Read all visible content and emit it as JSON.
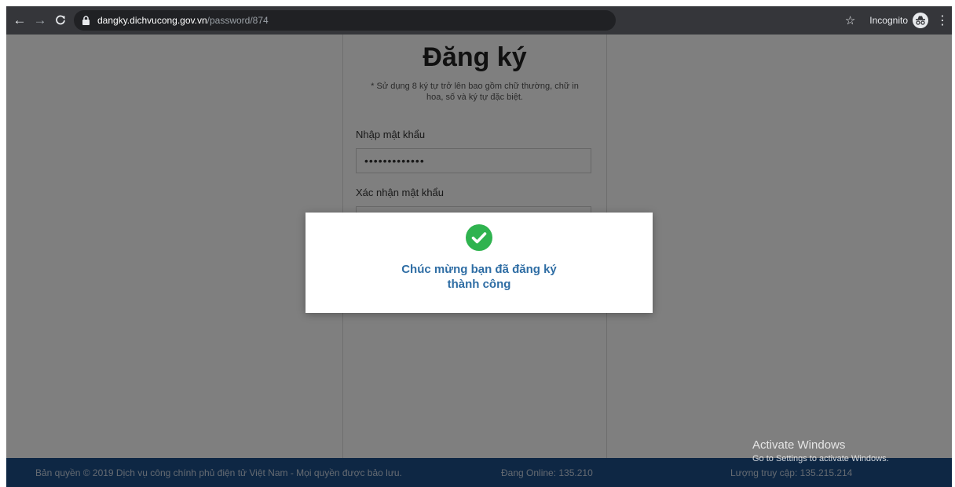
{
  "browser": {
    "url_host": "dangky.dichvucong.gov.vn",
    "url_path": "/password/874",
    "incognito_label": "Incognito",
    "icons": [
      "back-arrow-icon",
      "forward-arrow-icon",
      "reload-icon",
      "lock-icon",
      "star-icon",
      "incognito-icon",
      "menu-icon"
    ]
  },
  "card": {
    "title": "Đăng ký",
    "note": "* Sử dụng 8 ký tự trở lên bao gồm chữ thường, chữ in hoa, số và ký tự đặc biệt.",
    "password_label": "Nhập mật khẩu",
    "password_value": "•••••••••••••",
    "confirm_label": "Xác nhận mật khẩu"
  },
  "modal": {
    "icon": "check-circle-icon",
    "message": "Chúc mừng bạn đã đăng ký thành công",
    "accent": "#2e6da4",
    "check_color": "#2fb34f"
  },
  "footer": {
    "copyright": "Bản quyền © 2019 Dịch vụ công chính phủ điện tử Việt Nam - Mọi quyền được bảo lưu.",
    "online": "Đang Online: 135.210",
    "visits": "Lượng truy cập: 135.215.214",
    "background": "#1d4e89"
  },
  "watermark": {
    "title": "Activate Windows",
    "subtitle": "Go to Settings to activate Windows."
  }
}
